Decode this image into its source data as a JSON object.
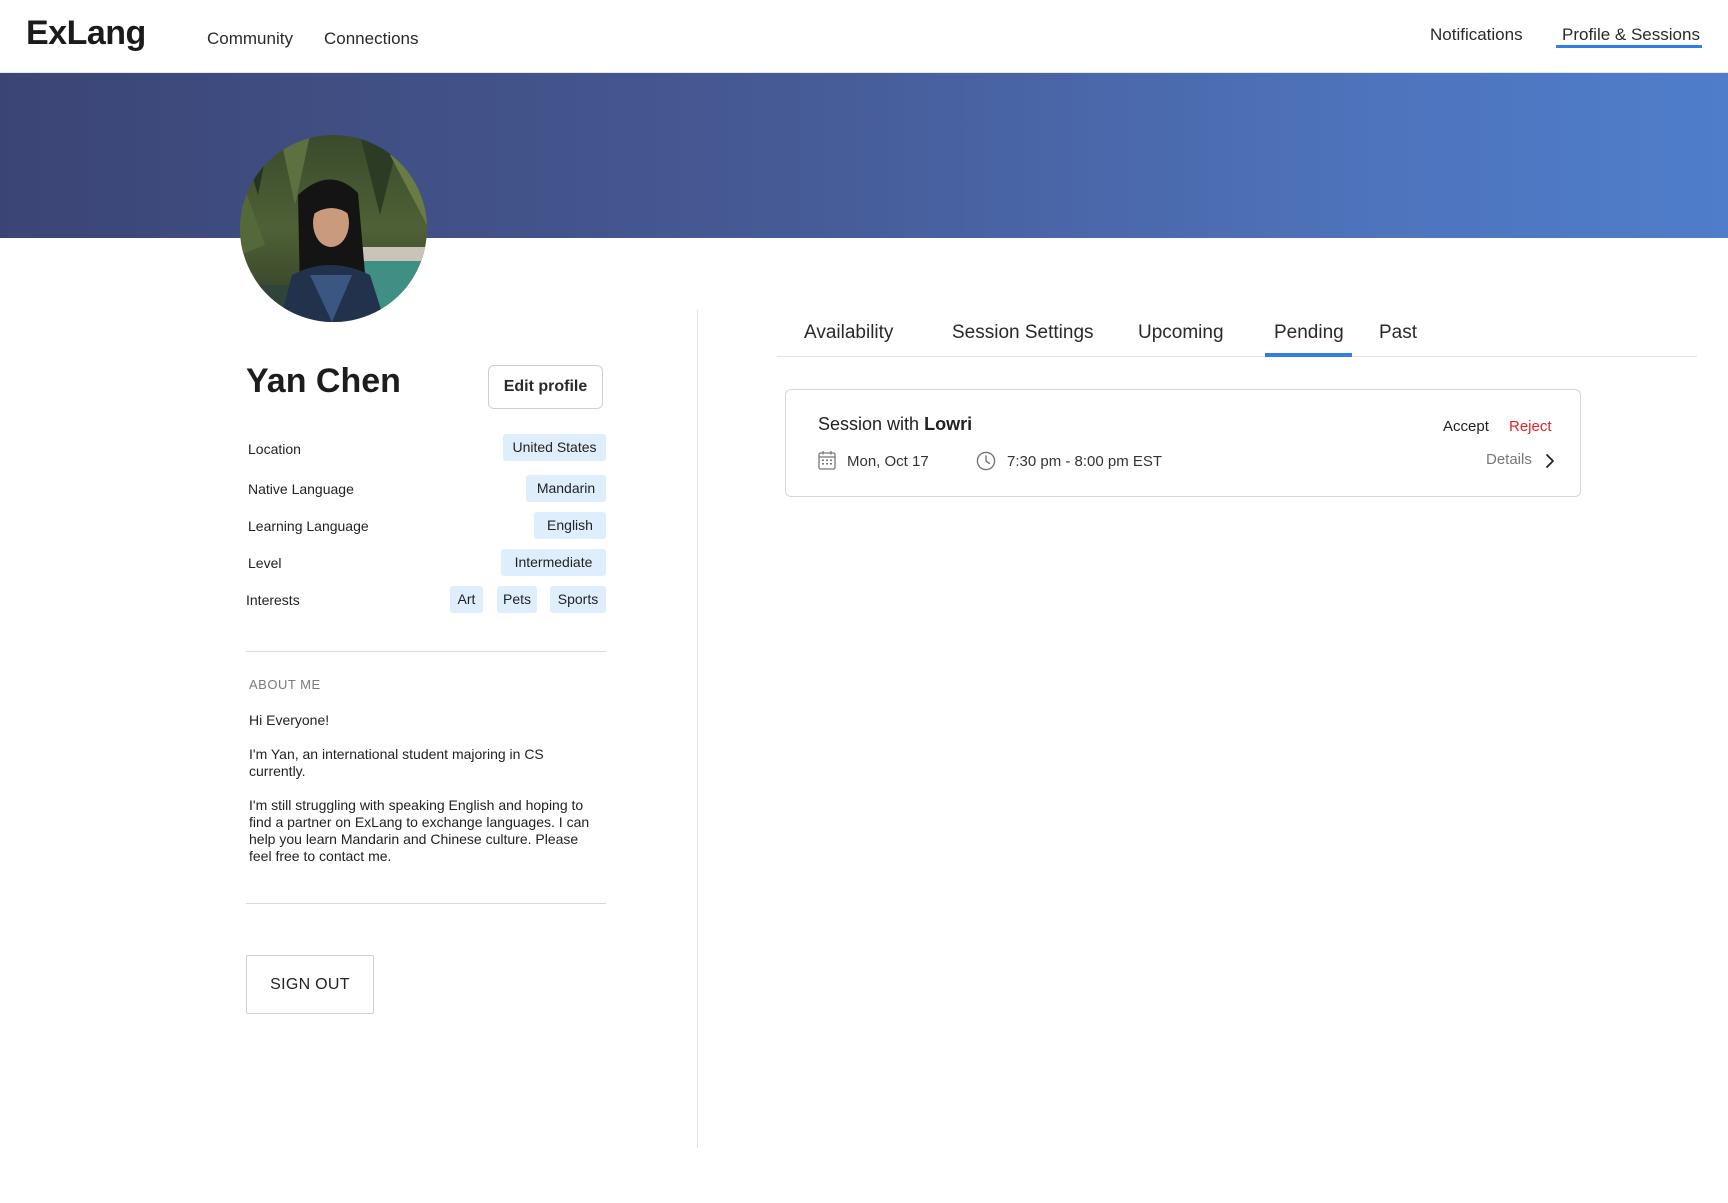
{
  "app": {
    "logo": "ExLang",
    "nav_left": [
      "Community",
      "Connections"
    ],
    "nav_right": [
      "Notifications",
      "Profile & Sessions"
    ],
    "accent_color": "#2f80e0"
  },
  "profile": {
    "name": "Yan Chen",
    "edit_label": "Edit  profile",
    "labels": {
      "location": "Location",
      "native": "Native Language",
      "learning": "Learning Language",
      "level": "Level",
      "interests": "Interests"
    },
    "values": {
      "location": "United States",
      "native": "Mandarin",
      "learning": "English",
      "level": "Intermediate",
      "interests": [
        "Art",
        "Pets",
        "Sports"
      ]
    },
    "about_title": "ABOUT  ME",
    "about": [
      "Hi Everyone!",
      "I'm Yan, an international student majoring in CS currently.",
      "I'm still struggling with speaking English and hoping to find a partner on ExLang to exchange languages. I can help you learn Mandarin and Chinese culture. Please feel free to contact me."
    ],
    "signout_label": "SIGN OUT"
  },
  "tabs": [
    "Availability",
    "Session Settings",
    "Upcoming",
    "Pending",
    "Past"
  ],
  "active_tab": "Pending",
  "session": {
    "title_prefix": "Session with",
    "partner": "Lowri",
    "accept": "Accept",
    "reject": "Reject",
    "date": "Mon, Oct 17",
    "time": "7:30 pm - 8:00 pm EST",
    "details": "Details",
    "reject_color": "#e02424"
  }
}
